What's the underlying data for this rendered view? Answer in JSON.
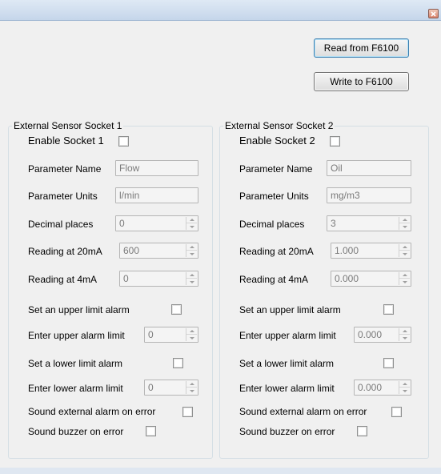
{
  "buttons": {
    "read": "Read from F6100",
    "write": "Write to F6100"
  },
  "socket1": {
    "title": "External Sensor Socket 1",
    "enable_label": "Enable Socket 1",
    "param_name_label": "Parameter Name",
    "param_name_value": "Flow",
    "param_units_label": "Parameter Units",
    "param_units_value": "l/min",
    "decimal_label": "Decimal places",
    "decimal_value": "0",
    "reading20_label": "Reading at 20mA",
    "reading20_value": "600",
    "reading4_label": "Reading at 4mA",
    "reading4_value": "0",
    "upper_alarm_label": "Set an upper limit alarm",
    "upper_limit_label": "Enter upper alarm limit",
    "upper_limit_value": "0",
    "lower_alarm_label": "Set a lower limit alarm",
    "lower_limit_label": "Enter lower alarm limit",
    "lower_limit_value": "0",
    "sound_ext_label": "Sound external alarm on error",
    "buzzer_label": "Sound buzzer on error"
  },
  "socket2": {
    "title": "External Sensor Socket 2",
    "enable_label": "Enable Socket 2",
    "param_name_label": "Parameter Name",
    "param_name_value": "Oil",
    "param_units_label": "Parameter Units",
    "param_units_value": "mg/m3",
    "decimal_label": "Decimal places",
    "decimal_value": "3",
    "reading20_label": "Reading at 20mA",
    "reading20_value": "1.000",
    "reading4_label": "Reading at 4mA",
    "reading4_value": "0.000",
    "upper_alarm_label": "Set an upper limit alarm",
    "upper_limit_label": "Enter upper alarm limit",
    "upper_limit_value": "0.000",
    "lower_alarm_label": "Set a lower limit alarm",
    "lower_limit_label": "Enter lower alarm limit",
    "lower_limit_value": "0.000",
    "sound_ext_label": "Sound external alarm on error",
    "buzzer_label": "Sound buzzer on error"
  },
  "icons": {
    "close": "close-icon",
    "spin_up": "spin-up-arrow-icon",
    "spin_down": "spin-down-arrow-icon"
  },
  "colors": {
    "titlebar": "#c5d6ea",
    "client": "#f0f0f0",
    "close_button": "#d9826a",
    "group_border": "#d5dfe5"
  }
}
